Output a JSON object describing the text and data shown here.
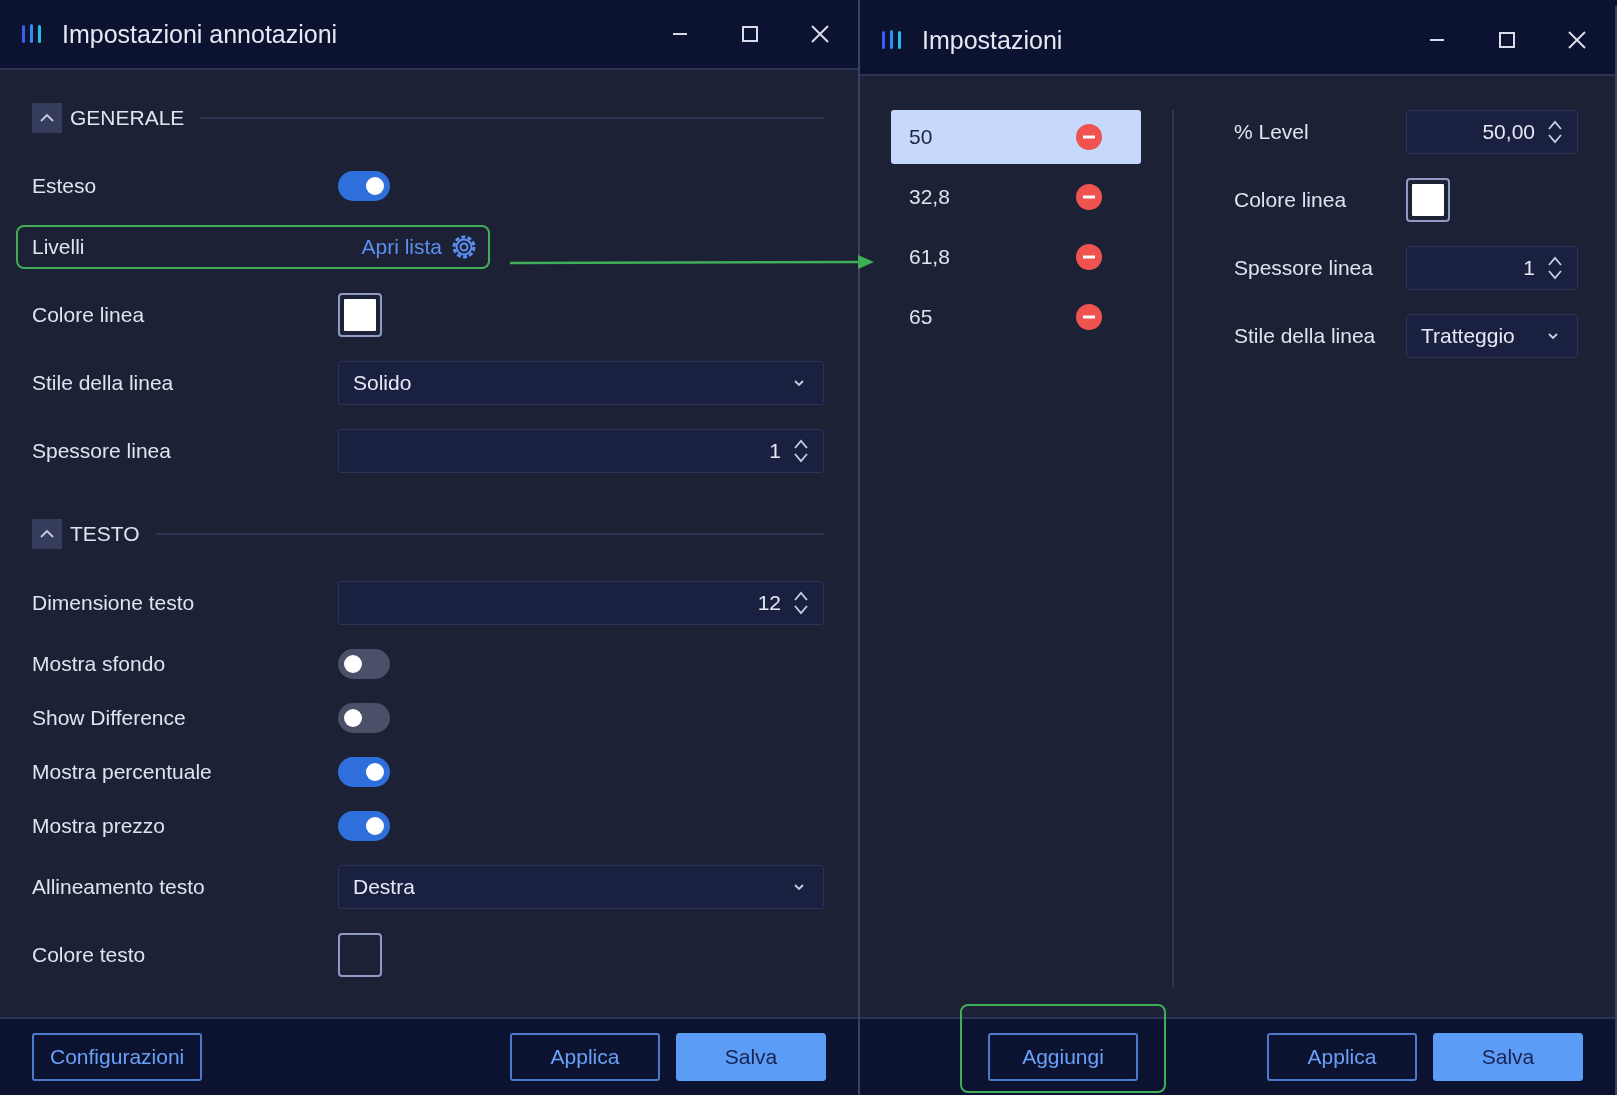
{
  "left_window": {
    "title": "Impostazioni annotazioni",
    "sections": [
      {
        "title": "GENERALE",
        "expanded": true,
        "rows": [
          {
            "kind": "toggle",
            "label": "Esteso",
            "on": true
          },
          {
            "kind": "link",
            "label": "Livelli",
            "link": "Apri lista",
            "highlighted": true
          },
          {
            "kind": "color",
            "label": "Colore linea",
            "color": "#ffffff"
          },
          {
            "kind": "select",
            "label": "Stile della linea",
            "value": "Solido"
          },
          {
            "kind": "number",
            "label": "Spessore linea",
            "value": "1"
          }
        ]
      },
      {
        "title": "TESTO",
        "expanded": true,
        "rows": [
          {
            "kind": "number",
            "label": "Dimensione testo",
            "value": "12"
          },
          {
            "kind": "toggle",
            "label": "Mostra sfondo",
            "on": false
          },
          {
            "kind": "toggle",
            "label": "Show Difference",
            "on": false
          },
          {
            "kind": "toggle",
            "label": "Mostra percentuale",
            "on": true
          },
          {
            "kind": "toggle",
            "label": "Mostra prezzo",
            "on": true
          },
          {
            "kind": "select",
            "label": "Allineamento testo",
            "value": "Destra"
          },
          {
            "kind": "color",
            "label": "Colore testo",
            "color": "#1d2136"
          }
        ]
      }
    ],
    "buttons": [
      {
        "label": "Configurazioni",
        "kind": "outline"
      },
      {
        "label": "Applica",
        "kind": "outline"
      },
      {
        "label": "Salva",
        "kind": "primary"
      }
    ]
  },
  "right_window": {
    "title": "Impostazioni",
    "levels": [
      {
        "value": "50",
        "selected": true
      },
      {
        "value": "32,8",
        "selected": false
      },
      {
        "value": "61,8",
        "selected": false
      },
      {
        "value": "65",
        "selected": false
      }
    ],
    "fields": [
      {
        "kind": "number",
        "label": "% Level",
        "value": "50,00"
      },
      {
        "kind": "color",
        "label": "Colore linea",
        "color": "#ffffff"
      },
      {
        "kind": "number",
        "label": "Spessore linea",
        "value": "1"
      },
      {
        "kind": "select",
        "label": "Stile della linea",
        "value": "Tratteggio"
      }
    ],
    "buttons": [
      {
        "label": "Aggiungi",
        "kind": "outline",
        "highlighted": true
      },
      {
        "label": "Applica",
        "kind": "outline"
      },
      {
        "label": "Salva",
        "kind": "primary"
      }
    ]
  }
}
